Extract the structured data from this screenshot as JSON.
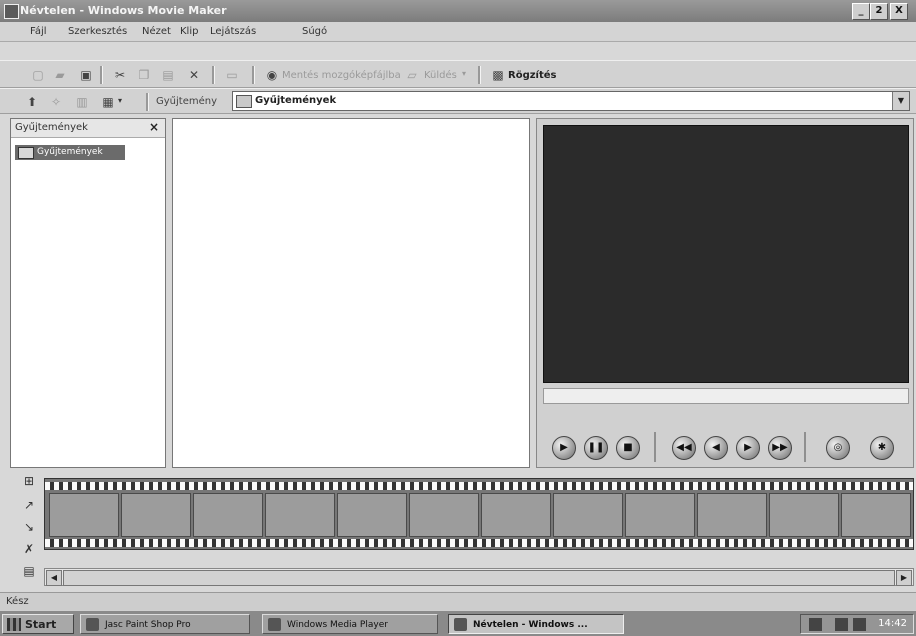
{
  "window": {
    "title": "Névtelen - Windows Movie Maker",
    "controls": [
      "_",
      "2",
      "X"
    ]
  },
  "menu": [
    "Fájl",
    "Szerkesztés",
    "Nézet",
    "Klip",
    "Lejátszás",
    "Súgó"
  ],
  "toolbar1": {
    "buttons": [
      "new-icon",
      "open-icon",
      "save-icon",
      "cut-icon",
      "copy-icon",
      "paste-icon",
      "delete-icon",
      "properties-icon"
    ],
    "send_label": "Mentés mozgóképfájlba",
    "import_label": "Küldés",
    "record_label": "Rögzítés"
  },
  "toolbar2": {
    "collection_label": "Gyűjtemény",
    "address_value": "Gyűjtemények"
  },
  "collections_pane": {
    "header": "Gyűjtemények",
    "close": "×",
    "items": [
      "Gyűjtemények"
    ]
  },
  "player_controls": [
    "play-icon",
    "pause-icon",
    "stop-icon",
    "back-icon",
    "previous-frame-icon",
    "next-frame-icon",
    "forward-icon",
    "full-screen-icon",
    "split-clip-icon"
  ],
  "status": "Kész",
  "taskbar": {
    "start": "Start",
    "items": [
      "Jasc Paint Shop Pro",
      "Windows Media Player",
      "Névtelen - Windows ..."
    ],
    "clock": "14:42"
  }
}
